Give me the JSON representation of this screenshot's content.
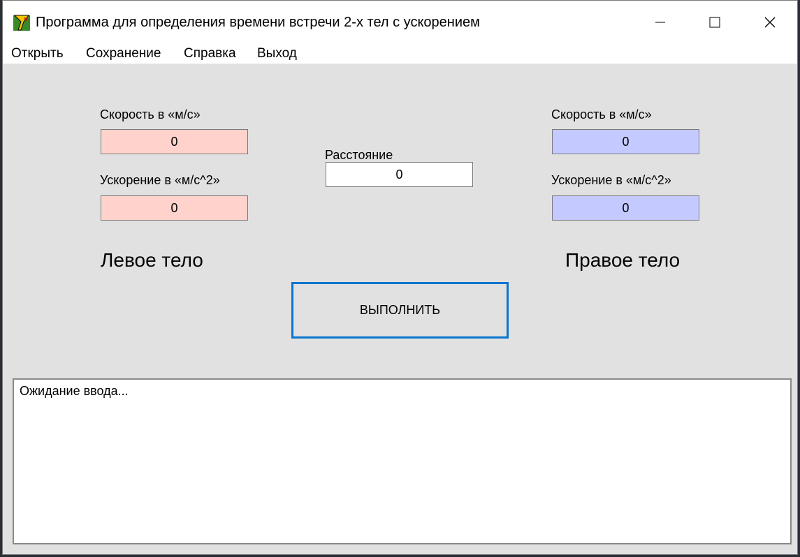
{
  "window": {
    "title": "Программа для определения времени встречи 2-х тел с ускорением",
    "icon": "app-icon"
  },
  "menu": {
    "open": "Открыть",
    "save": "Сохранение",
    "help": "Справка",
    "exit": "Выход"
  },
  "left_body": {
    "speed_label": "Скорость в «м/с»",
    "speed_value": "0",
    "accel_label": "Ускорение в «м/с^2»",
    "accel_value": "0",
    "title": "Левое тело",
    "color": "#ffd2cc"
  },
  "distance": {
    "label": "Расстояние",
    "value": "0"
  },
  "right_body": {
    "speed_label": "Скорость в «м/с»",
    "speed_value": "0",
    "accel_label": "Ускорение в «м/с^2»",
    "accel_value": "0",
    "title": "Правое тело",
    "color": "#c4caff"
  },
  "run_button": "ВЫПОЛНИТЬ",
  "output": {
    "text": "Ожидание ввода..."
  }
}
